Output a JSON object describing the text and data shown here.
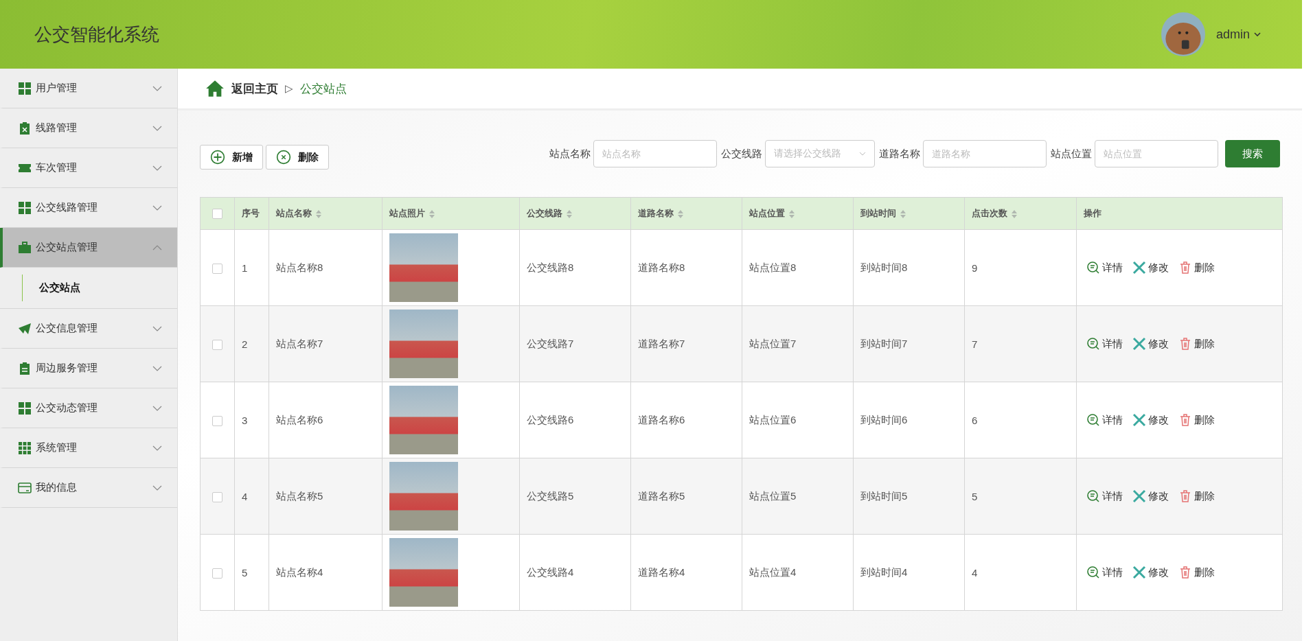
{
  "header": {
    "title": "公交智能化系统",
    "user": "admin"
  },
  "sidebar": {
    "items": [
      {
        "label": "用户管理",
        "expanded": false,
        "selected": false
      },
      {
        "label": "线路管理",
        "expanded": false,
        "selected": false
      },
      {
        "label": "车次管理",
        "expanded": false,
        "selected": false
      },
      {
        "label": "公交线路管理",
        "expanded": false,
        "selected": false
      },
      {
        "label": "公交站点管理",
        "expanded": true,
        "selected": true,
        "children": [
          {
            "label": "公交站点",
            "selected": true
          }
        ]
      },
      {
        "label": "公交信息管理",
        "expanded": false,
        "selected": false
      },
      {
        "label": "周边服务管理",
        "expanded": false,
        "selected": false
      },
      {
        "label": "公交动态管理",
        "expanded": false,
        "selected": false
      },
      {
        "label": "系统管理",
        "expanded": false,
        "selected": false
      },
      {
        "label": "我的信息",
        "expanded": false,
        "selected": false
      }
    ]
  },
  "breadcrumb": {
    "home": "返回主页",
    "separator": "▷",
    "current": "公交站点"
  },
  "toolbar": {
    "buttons": [
      {
        "label": "新增",
        "kind": "add"
      },
      {
        "label": "删除",
        "kind": "delete"
      }
    ]
  },
  "search": {
    "fields": [
      {
        "label": "站点名称",
        "placeholder": "站点名称",
        "kind": "input"
      },
      {
        "label": "公交线路",
        "placeholder": "请选择公交线路",
        "kind": "select"
      },
      {
        "label": "道路名称",
        "placeholder": "道路名称",
        "kind": "input"
      },
      {
        "label": "站点位置",
        "placeholder": "站点位置",
        "kind": "input"
      }
    ],
    "button": "搜索"
  },
  "table": {
    "select_all_checked": false,
    "columns": [
      {
        "label": "序号",
        "kind": "text",
        "sortable": false
      },
      {
        "label": "站点名称",
        "kind": "text",
        "sortable": true
      },
      {
        "label": "站点照片",
        "kind": "photo",
        "sortable": true
      },
      {
        "label": "公交线路",
        "kind": "text",
        "sortable": true
      },
      {
        "label": "道路名称",
        "kind": "text",
        "sortable": true
      },
      {
        "label": "站点位置",
        "kind": "text",
        "sortable": true
      },
      {
        "label": "到站时间",
        "kind": "text",
        "sortable": true
      },
      {
        "label": "点击次数",
        "kind": "text",
        "sortable": true
      },
      {
        "label": "操作",
        "kind": "actions",
        "sortable": false
      }
    ],
    "rows": [
      {
        "checked": false,
        "cells": [
          "1",
          "站点名称8",
          "",
          "公交线路8",
          "道路名称8",
          "站点位置8",
          "到站时间8",
          "9"
        ],
        "actions": [
          {
            "label": "详情",
            "kind": "detail"
          },
          {
            "label": "修改",
            "kind": "edit"
          },
          {
            "label": "删除",
            "kind": "delete"
          }
        ]
      },
      {
        "checked": false,
        "cells": [
          "2",
          "站点名称7",
          "",
          "公交线路7",
          "道路名称7",
          "站点位置7",
          "到站时间7",
          "7"
        ],
        "actions": [
          {
            "label": "详情",
            "kind": "detail"
          },
          {
            "label": "修改",
            "kind": "edit"
          },
          {
            "label": "删除",
            "kind": "delete"
          }
        ]
      },
      {
        "checked": false,
        "cells": [
          "3",
          "站点名称6",
          "",
          "公交线路6",
          "道路名称6",
          "站点位置6",
          "到站时间6",
          "6"
        ],
        "actions": [
          {
            "label": "详情",
            "kind": "detail"
          },
          {
            "label": "修改",
            "kind": "edit"
          },
          {
            "label": "删除",
            "kind": "delete"
          }
        ]
      },
      {
        "checked": false,
        "cells": [
          "4",
          "站点名称5",
          "",
          "公交线路5",
          "道路名称5",
          "站点位置5",
          "到站时间5",
          "5"
        ],
        "actions": [
          {
            "label": "详情",
            "kind": "detail"
          },
          {
            "label": "修改",
            "kind": "edit"
          },
          {
            "label": "删除",
            "kind": "delete"
          }
        ]
      },
      {
        "checked": false,
        "cells": [
          "5",
          "站点名称4",
          "",
          "公交线路4",
          "道路名称4",
          "站点位置4",
          "到站时间4",
          "4"
        ],
        "actions": [
          {
            "label": "详情",
            "kind": "detail"
          },
          {
            "label": "修改",
            "kind": "edit"
          },
          {
            "label": "删除",
            "kind": "delete"
          }
        ]
      }
    ]
  }
}
